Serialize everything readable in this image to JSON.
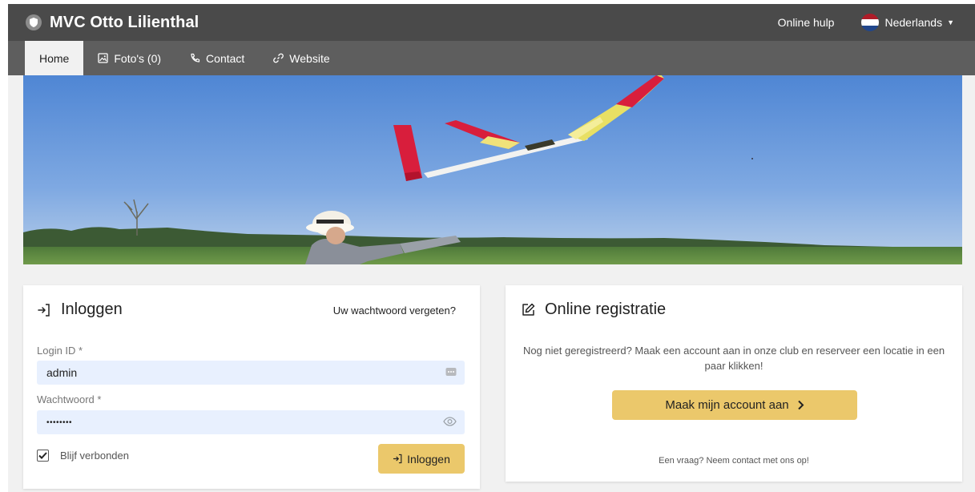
{
  "header": {
    "title": "MVC Otto Lilienthal",
    "help_label": "Online hulp",
    "language": "Nederlands"
  },
  "nav": {
    "tabs": [
      {
        "label": "Home",
        "icon": "none",
        "active": true
      },
      {
        "label": "Foto's (0)",
        "icon": "image-icon"
      },
      {
        "label": "Contact",
        "icon": "phone-icon"
      },
      {
        "label": "Website",
        "icon": "link-icon"
      }
    ]
  },
  "login": {
    "title": "Inloggen",
    "forgot_label": "Uw wachtwoord vergeten?",
    "login_id_label": "Login ID *",
    "login_id_value": "admin",
    "password_label": "Wachtwoord *",
    "password_value": "••••••••",
    "remember_label": "Blijf verbonden",
    "remember_checked": true,
    "submit_label": "Inloggen"
  },
  "registration": {
    "title": "Online registratie",
    "description": "Nog niet geregistreerd? Maak een account aan in onze club en reserveer een locatie in een paar klikken!",
    "button_label": "Maak mijn account aan",
    "footer": "Een vraag? Neem contact met ons op!"
  },
  "colors": {
    "topbar": "#4a4a4a",
    "navbar": "#5e5e5e",
    "accent": "#ebc86b",
    "field_bg": "#e8f0fe"
  }
}
